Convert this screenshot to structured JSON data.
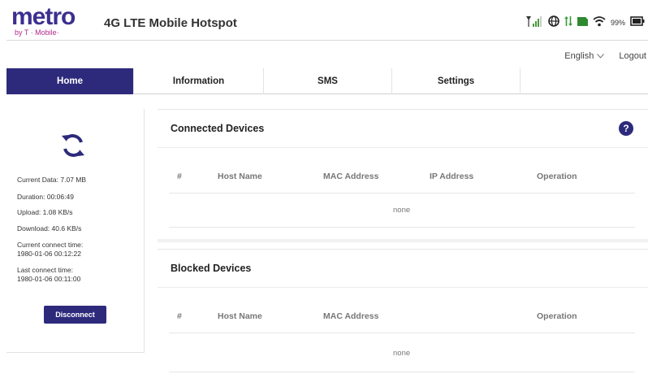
{
  "header": {
    "logo_word": "metro",
    "logo_sub": "by T · Mobile·",
    "title": "4G LTE Mobile Hotspot",
    "battery_text": "99%"
  },
  "toprow": {
    "language": "English",
    "logout": "Logout"
  },
  "nav": {
    "tabs": [
      "Home",
      "Information",
      "SMS",
      "Settings"
    ]
  },
  "stats": {
    "current_data": "Current Data: 7.07 MB",
    "duration": "Duration: 00:06:49",
    "upload": "Upload: 1.08 KB/s",
    "download": "Download: 40.6 KB/s",
    "current_connect_label": "Current connect time:",
    "current_connect_value": "1980-01-06 00:12:22",
    "last_connect_label": "Last connect time:",
    "last_connect_value": "1980-01-06 00:11:00",
    "disconnect_label": "Disconnect"
  },
  "connected": {
    "title": "Connected Devices",
    "columns": [
      "#",
      "Host Name",
      "MAC Address",
      "IP Address",
      "Operation"
    ],
    "empty": "none"
  },
  "blocked": {
    "title": "Blocked Devices",
    "columns": [
      "#",
      "Host Name",
      "MAC Address",
      "Operation"
    ],
    "empty": "none"
  },
  "colors": {
    "brand": "#2d2a7c",
    "logo_accent": "#b02a8a"
  }
}
